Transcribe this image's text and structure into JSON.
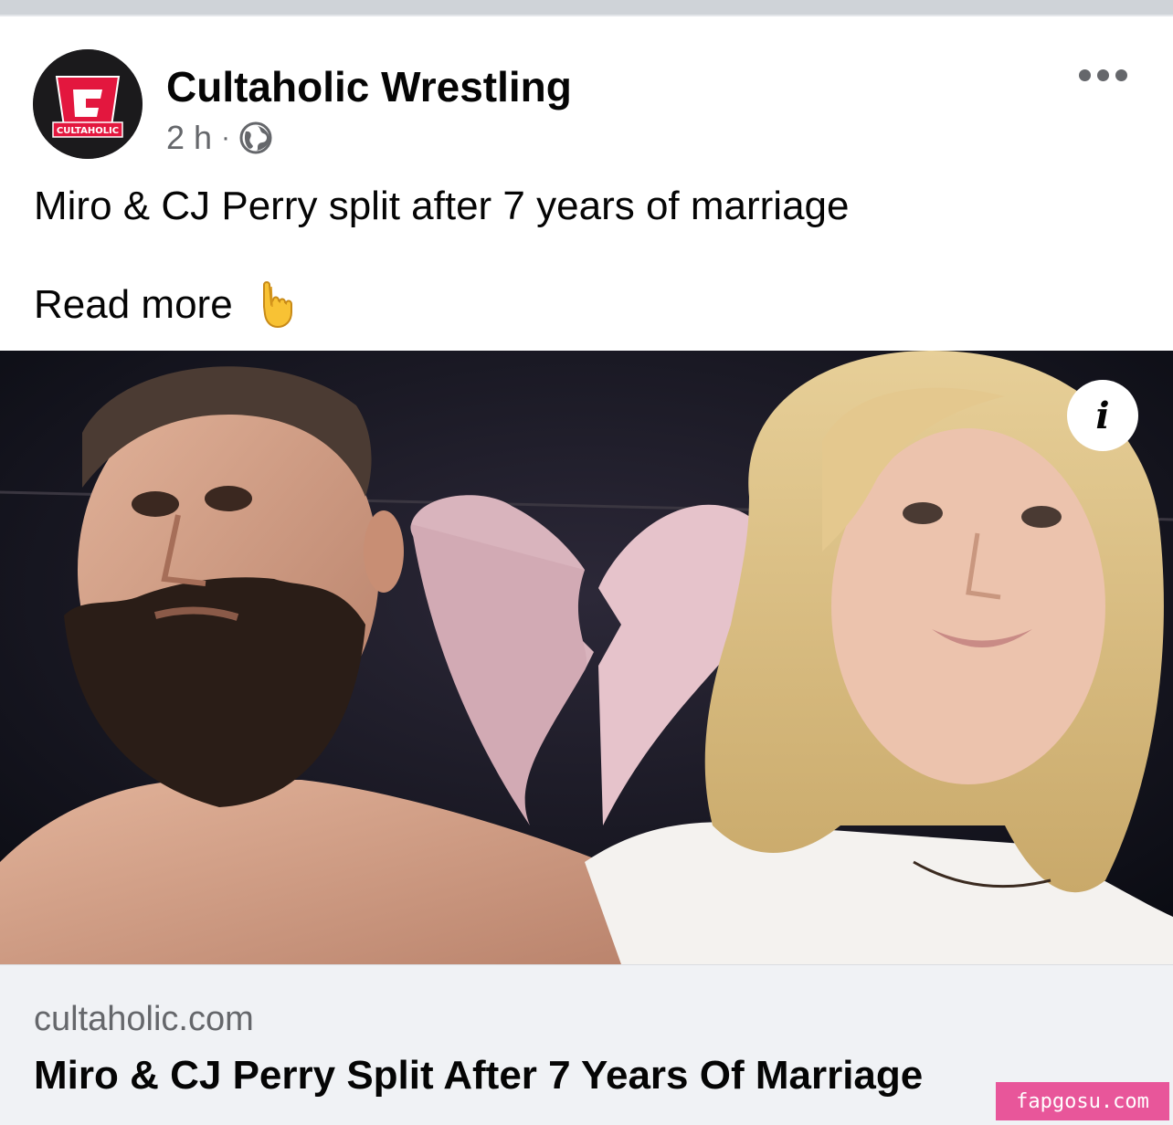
{
  "post": {
    "page_name": "Cultaholic Wrestling",
    "avatar_text": "CULTAHOLIC",
    "time": "2 h",
    "separator": "·",
    "privacy_icon": "globe-icon",
    "more_icon": "more-options-icon",
    "text": "Miro & CJ Perry split after 7 years of marriage",
    "read_more": "Read more",
    "read_more_emoji": "backhand-index-pointing-down"
  },
  "link_preview": {
    "domain": "cultaholic.com",
    "title": "Miro & CJ Perry Split After 7 Years Of Marriage",
    "info_icon_label": "i"
  },
  "watermark": "fapgosu.com",
  "colors": {
    "text_primary": "#050505",
    "text_secondary": "#65676b",
    "card_background": "#f0f2f5",
    "brand_red": "#e3173e",
    "watermark": "#e8569a"
  }
}
